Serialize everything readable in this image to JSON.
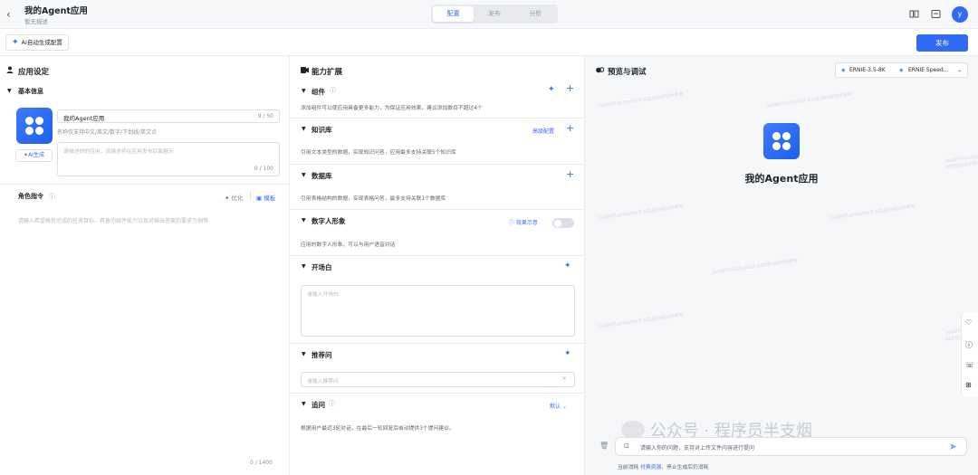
{
  "header": {
    "back": "‹",
    "title": "我的Agent应用",
    "desc": "暂无描述",
    "tabs": [
      "配置",
      "发布",
      "分析"
    ],
    "avatar": "y"
  },
  "toolbar": {
    "ai_config": "AI自动生成配置",
    "publish": "发布"
  },
  "app_settings": {
    "title": "应用设定",
    "basic": "基本信息",
    "name_value": "我的Agent应用",
    "name_count": "9 / 50",
    "name_hint": "名称仅支持中文/英文/数字/下划线/英文点",
    "ai_gen": "AI生成",
    "desc_placeholder": "请描述你的应用，该描述将在应用发布后面展示",
    "desc_count": "0 / 100",
    "role_title": "角色指令",
    "optimize": "优化",
    "template": "模板",
    "role_placeholder": "请输入希望角色完成的任务目标、具备的组件能力以及对输出答案的要求引例等",
    "role_count": "0 / 1400"
  },
  "capabilities": {
    "title": "能力扩展",
    "components": {
      "title": "组件",
      "desc": "添加组件可以使应用具备更多能力，为保证应用效果，建议添加数目不超过4个"
    },
    "knowledge": {
      "title": "知识库",
      "advanced": "高级配置",
      "desc": "引用文本类型的数据，实现知识问答，应用最多支持关联5个知识库"
    },
    "database": {
      "title": "数据库",
      "desc": "引用表格结构的数据，实现表格问答，最多支持关联1个数据库"
    },
    "avatar": {
      "title": "数字人形象",
      "demo": "效果示意",
      "desc": "应用的数字人形象，可以与用户语音对话"
    },
    "opening": {
      "title": "开场白",
      "placeholder": "请输入开场白"
    },
    "recommend": {
      "title": "推荐问",
      "placeholder": "请输入推荐问"
    },
    "followup": {
      "title": "追问",
      "mode": "默认",
      "desc": "根据用户最近3轮对话，在最后一轮回复后自动提供3个提问建议。"
    }
  },
  "preview": {
    "title": "预览与调试",
    "model1": "ERNIE-3.5-8K",
    "model2": "ERNIE Speed...",
    "app_name": "我的Agent应用",
    "input_placeholder": "请输入你的问题，支持对上传文件内容进行提问",
    "footer_a": "当前消耗",
    "footer_link": "付费资源",
    "footer_b": "，停止生成后仍消耗",
    "watermark": "公众号 · 程序员半支烟",
    "wm_text": "3a08f97a02be5bc3 AI生成内容仅供参考"
  }
}
